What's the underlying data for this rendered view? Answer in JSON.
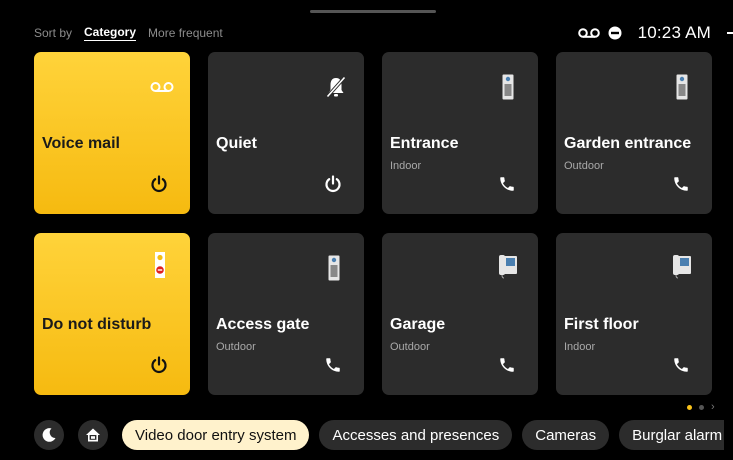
{
  "sort": {
    "label": "Sort by",
    "options": [
      {
        "label": "Category",
        "active": true
      },
      {
        "label": "More frequent",
        "active": false
      }
    ]
  },
  "status": {
    "icons": [
      "voicemail-icon",
      "do-not-disturb-icon"
    ],
    "time": "10:23 AM"
  },
  "tiles": [
    {
      "name": "Voice mail",
      "subtitle": "",
      "top_icon": "voicemail-icon",
      "action_icon": "power-icon",
      "highlighted": true
    },
    {
      "name": "Quiet",
      "subtitle": "",
      "top_icon": "bell-off-icon",
      "action_icon": "power-icon",
      "highlighted": false
    },
    {
      "name": "Entrance",
      "subtitle": "Indoor",
      "top_icon": "door-panel-icon",
      "action_icon": "phone-icon",
      "highlighted": false
    },
    {
      "name": "Garden entrance",
      "subtitle": "Outdoor",
      "top_icon": "door-panel-icon",
      "action_icon": "phone-icon",
      "highlighted": false
    },
    {
      "name": "Do not disturb",
      "subtitle": "",
      "top_icon": "door-hanger-icon",
      "action_icon": "power-icon",
      "highlighted": true
    },
    {
      "name": "Access gate",
      "subtitle": "Outdoor",
      "top_icon": "door-panel-icon",
      "action_icon": "phone-icon",
      "highlighted": false
    },
    {
      "name": "Garage",
      "subtitle": "Outdoor",
      "top_icon": "intercom-handset-icon",
      "action_icon": "phone-icon",
      "highlighted": false
    },
    {
      "name": "First floor",
      "subtitle": "Indoor",
      "top_icon": "intercom-handset-icon",
      "action_icon": "phone-icon",
      "highlighted": false
    }
  ],
  "pagination": {
    "current_page": 1,
    "total_pages": 2
  },
  "bottom": {
    "icon_buttons": [
      "moon-icon",
      "home-icon"
    ],
    "chips": [
      {
        "label": "Video door entry system",
        "active": true
      },
      {
        "label": "Accesses and presences",
        "active": false
      },
      {
        "label": "Cameras",
        "active": false
      },
      {
        "label": "Burglar alarm",
        "active": false
      }
    ]
  },
  "colors": {
    "accent": "#f9c21a",
    "tile": "#2c2c2c",
    "chip_active": "#fff2cc",
    "dot_inactive": "#555555"
  }
}
